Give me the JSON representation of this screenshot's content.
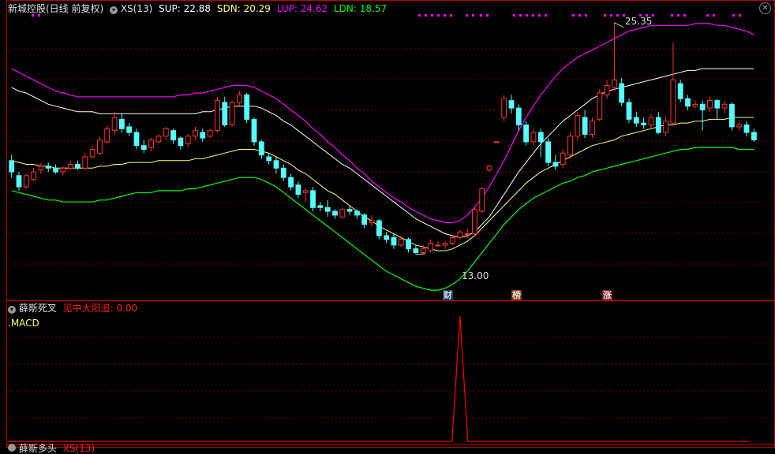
{
  "main_header": {
    "title": "新城控股(日线 前复权)",
    "indicator": "XS(13)",
    "sup_label": "SUP:",
    "sup": "22.88",
    "sdn_label": "SDN:",
    "sdn": "20.29",
    "lup_label": "LUP:",
    "lup": "24.62",
    "ldn_label": "LDN:",
    "ldn": "18.57"
  },
  "sub_header": {
    "name": "薛斯死叉",
    "signal_label": "见中大阳追:",
    "signal_value": "0.00",
    "macd_label": ".MACD"
  },
  "bottom_header": {
    "name": "薛斯多头",
    "text": "XS(13)"
  },
  "annotations": {
    "high": "25.35",
    "low": "13.00",
    "markers": [
      "财",
      "榜",
      "涨"
    ]
  },
  "colors": {
    "up": "#ff3232",
    "down": "#54ffff",
    "lup": "#ff00ff",
    "sup": "#ffffff",
    "sdn": "#ffff80",
    "ldn": "#00ff00",
    "frame": "#b40000",
    "grid": "#700000",
    "signal": "#ff0000"
  },
  "chart_data": {
    "type": "candlestick",
    "series": [
      {
        "name": "SUP"
      },
      {
        "name": "SDN"
      },
      {
        "name": "LUP"
      },
      {
        "name": "LDN"
      }
    ],
    "high": 25.35,
    "low": 13.0,
    "ohlc": [
      [
        18.0,
        17.4,
        18.3,
        17.1
      ],
      [
        17.2,
        16.6,
        17.4,
        16.4
      ],
      [
        16.6,
        17.2,
        17.3,
        16.5
      ],
      [
        17.0,
        17.4,
        17.6,
        16.9
      ],
      [
        17.5,
        17.7,
        17.9,
        17.3
      ],
      [
        17.7,
        17.6,
        17.9,
        17.4
      ],
      [
        17.6,
        17.4,
        17.8,
        17.3
      ],
      [
        17.4,
        17.6,
        17.7,
        17.2
      ],
      [
        17.6,
        17.8,
        18.0,
        17.5
      ],
      [
        17.8,
        17.6,
        18.0,
        17.5
      ],
      [
        17.6,
        18.2,
        18.4,
        17.5
      ],
      [
        18.2,
        18.6,
        18.8,
        18.1
      ],
      [
        18.4,
        19.1,
        19.3,
        18.3
      ],
      [
        19.0,
        19.7,
        19.9,
        18.9
      ],
      [
        19.6,
        20.3,
        20.6,
        19.4
      ],
      [
        20.2,
        19.7,
        20.5,
        19.5
      ],
      [
        19.8,
        19.5,
        20.0,
        19.3
      ],
      [
        19.5,
        18.8,
        19.7,
        18.6
      ],
      [
        18.8,
        18.6,
        19.1,
        18.4
      ],
      [
        18.7,
        19.1,
        19.2,
        18.5
      ],
      [
        19.0,
        19.3,
        19.4,
        18.9
      ],
      [
        19.3,
        19.7,
        19.8,
        19.1
      ],
      [
        19.6,
        19.1,
        19.7,
        18.9
      ],
      [
        19.2,
        18.8,
        19.3,
        18.6
      ],
      [
        18.9,
        19.3,
        19.4,
        18.7
      ],
      [
        19.3,
        19.6,
        19.8,
        19.1
      ],
      [
        19.5,
        19.2,
        19.7,
        19.0
      ],
      [
        19.3,
        19.6,
        19.7,
        19.2
      ],
      [
        19.6,
        21.2,
        21.4,
        19.5
      ],
      [
        21.1,
        19.9,
        21.4,
        19.8
      ],
      [
        19.9,
        21.1,
        21.2,
        19.8
      ],
      [
        21.1,
        21.5,
        21.7,
        20.9
      ],
      [
        21.5,
        20.2,
        21.6,
        20.0
      ],
      [
        20.2,
        19.0,
        20.3,
        18.8
      ],
      [
        19.0,
        18.3,
        19.1,
        18.1
      ],
      [
        18.2,
        18.0,
        18.4,
        17.8
      ],
      [
        18.0,
        17.6,
        18.2,
        17.3
      ],
      [
        17.6,
        17.1,
        17.8,
        16.9
      ],
      [
        17.1,
        16.6,
        17.3,
        16.4
      ],
      [
        16.7,
        16.2,
        16.9,
        16.0
      ],
      [
        16.3,
        16.4,
        16.5,
        15.8
      ],
      [
        16.4,
        15.5,
        16.6,
        15.3
      ],
      [
        15.6,
        15.5,
        15.8,
        15.3
      ],
      [
        15.5,
        15.3,
        15.9,
        15.0
      ],
      [
        15.3,
        15.1,
        15.4,
        14.9
      ],
      [
        15.0,
        15.4,
        15.5,
        14.9
      ],
      [
        15.4,
        15.3,
        15.6,
        15.1
      ],
      [
        15.3,
        15.1,
        15.4,
        14.9
      ],
      [
        15.1,
        14.6,
        15.2,
        14.4
      ],
      [
        14.7,
        14.8,
        15.1,
        14.5
      ],
      [
        14.8,
        14.0,
        14.9,
        13.8
      ],
      [
        14.0,
        13.8,
        14.2,
        13.6
      ],
      [
        13.9,
        13.5,
        14.1,
        13.3
      ],
      [
        13.5,
        13.8,
        13.9,
        13.4
      ],
      [
        13.8,
        13.3,
        13.9,
        13.1
      ],
      [
        13.3,
        13.1,
        13.5,
        13.0
      ],
      [
        13.1,
        13.3,
        13.5,
        13.0
      ],
      [
        13.2,
        13.6,
        13.8,
        13.1
      ],
      [
        13.5,
        13.5,
        13.7,
        13.4
      ],
      [
        13.5,
        13.6,
        13.7,
        13.3
      ],
      [
        13.6,
        13.9,
        14.0,
        13.5
      ],
      [
        13.9,
        14.2,
        14.3,
        13.8
      ],
      [
        14.1,
        14.1,
        14.4,
        13.9
      ],
      [
        14.1,
        15.4,
        15.5,
        14.0
      ],
      [
        15.3,
        16.5,
        16.6,
        15.2
      ],
      [
        17.5,
        17.7,
        17.8,
        17.4
      ],
      [
        19.0,
        19.0,
        19.0,
        19.0
      ],
      [
        20.3,
        21.3,
        21.5,
        20.1
      ],
      [
        21.2,
        20.8,
        21.5,
        20.5
      ],
      [
        20.8,
        19.9,
        21.0,
        19.6
      ],
      [
        19.9,
        19.0,
        20.1,
        18.8
      ],
      [
        19.0,
        19.5,
        19.7,
        18.8
      ],
      [
        19.5,
        19.0,
        19.7,
        18.2
      ],
      [
        19.0,
        17.9,
        19.2,
        17.7
      ],
      [
        17.9,
        17.7,
        18.3,
        17.5
      ],
      [
        17.8,
        18.4,
        18.6,
        17.6
      ],
      [
        18.3,
        19.3,
        19.5,
        18.1
      ],
      [
        19.3,
        20.4,
        20.6,
        19.1
      ],
      [
        20.3,
        19.4,
        20.7,
        19.2
      ],
      [
        19.4,
        20.1,
        20.3,
        19.2
      ],
      [
        20.2,
        21.6,
        21.8,
        20.1
      ],
      [
        21.5,
        22.0,
        22.3,
        21.3
      ],
      [
        21.9,
        22.3,
        25.35,
        21.7
      ],
      [
        22.1,
        21.1,
        22.4,
        20.9
      ],
      [
        21.1,
        20.2,
        21.3,
        20.0
      ],
      [
        20.3,
        20.0,
        20.6,
        19.8
      ],
      [
        20.0,
        19.9,
        20.3,
        19.7
      ],
      [
        19.9,
        20.3,
        20.5,
        19.7
      ],
      [
        20.3,
        19.5,
        20.6,
        19.4
      ],
      [
        19.5,
        20.1,
        20.3,
        19.3
      ],
      [
        20.0,
        22.3,
        24.3,
        19.9
      ],
      [
        22.1,
        21.3,
        22.3,
        21.1
      ],
      [
        21.3,
        20.9,
        21.5,
        20.7
      ],
      [
        20.9,
        21.0,
        21.2,
        20.8
      ],
      [
        21.0,
        20.7,
        21.2,
        19.6
      ],
      [
        20.8,
        21.2,
        21.4,
        20.6
      ],
      [
        21.2,
        20.8,
        21.3,
        20.2
      ],
      [
        20.8,
        21.0,
        21.2,
        20.5
      ],
      [
        21.0,
        19.8,
        21.1,
        19.6
      ],
      [
        19.8,
        19.9,
        20.1,
        19.6
      ],
      [
        19.9,
        19.5,
        20.1,
        19.3
      ],
      [
        19.5,
        19.1,
        19.7,
        19.0
      ]
    ],
    "sup": [
      21.9,
      21.7,
      21.6,
      21.4,
      21.2,
      21.0,
      20.9,
      20.8,
      20.7,
      20.6,
      20.6,
      20.6,
      20.5,
      20.5,
      20.5,
      20.5,
      20.5,
      20.5,
      20.5,
      20.5,
      20.5,
      20.5,
      20.5,
      20.5,
      20.5,
      20.5,
      20.6,
      20.6,
      20.7,
      20.8,
      20.9,
      20.9,
      20.9,
      20.9,
      20.8,
      20.6,
      20.4,
      20.1,
      19.9,
      19.6,
      19.3,
      19.0,
      18.7,
      18.4,
      18.1,
      17.8,
      17.6,
      17.3,
      17.0,
      16.7,
      16.4,
      16.1,
      15.8,
      15.5,
      15.2,
      14.9,
      14.7,
      14.5,
      14.3,
      14.1,
      14.0,
      13.9,
      14.0,
      14.2,
      14.6,
      15.0,
      15.6,
      16.2,
      16.8,
      17.4,
      17.9,
      18.4,
      18.9,
      19.3,
      19.7,
      20.1,
      20.4,
      20.7,
      21.0,
      21.3,
      21.5,
      21.7,
      21.8,
      21.9,
      22.0,
      22.1,
      22.2,
      22.3,
      22.4,
      22.5,
      22.6,
      22.7,
      22.8,
      22.8,
      22.9,
      22.9,
      22.9,
      22.9,
      22.9,
      22.9,
      22.9,
      22.9
    ],
    "sdn": [
      18.0,
      17.9,
      17.8,
      17.8,
      17.7,
      17.7,
      17.6,
      17.6,
      17.6,
      17.6,
      17.6,
      17.6,
      17.7,
      17.7,
      17.8,
      17.8,
      17.9,
      17.9,
      17.9,
      17.9,
      18.0,
      18.0,
      18.0,
      18.0,
      18.0,
      18.1,
      18.1,
      18.2,
      18.3,
      18.4,
      18.5,
      18.6,
      18.6,
      18.6,
      18.5,
      18.4,
      18.2,
      18.0,
      17.8,
      17.5,
      17.3,
      17.0,
      16.7,
      16.4,
      16.2,
      15.9,
      15.6,
      15.3,
      15.0,
      14.8,
      14.5,
      14.3,
      14.1,
      13.9,
      13.7,
      13.5,
      13.4,
      13.3,
      13.2,
      13.2,
      13.3,
      13.5,
      13.7,
      14.0,
      14.4,
      14.8,
      15.2,
      15.6,
      16.0,
      16.4,
      16.8,
      17.1,
      17.4,
      17.6,
      17.8,
      18.0,
      18.2,
      18.4,
      18.6,
      18.8,
      18.9,
      19.0,
      19.1,
      19.3,
      19.4,
      19.5,
      19.6,
      19.7,
      19.8,
      19.9,
      19.9,
      20.0,
      20.0,
      20.1,
      20.1,
      20.2,
      20.2,
      20.2,
      20.3,
      20.3,
      20.3,
      20.3
    ],
    "lup": [
      22.9,
      22.7,
      22.5,
      22.3,
      22.1,
      21.9,
      21.7,
      21.6,
      21.5,
      21.4,
      21.4,
      21.4,
      21.4,
      21.4,
      21.4,
      21.4,
      21.4,
      21.4,
      21.4,
      21.4,
      21.4,
      21.4,
      21.4,
      21.5,
      21.5,
      21.6,
      21.6,
      21.7,
      21.8,
      21.9,
      22.0,
      22.0,
      22.0,
      21.9,
      21.7,
      21.5,
      21.3,
      21.0,
      20.7,
      20.4,
      20.1,
      19.7,
      19.4,
      19.0,
      18.7,
      18.3,
      18.0,
      17.6,
      17.3,
      16.9,
      16.6,
      16.3,
      16.0,
      15.8,
      15.5,
      15.3,
      15.1,
      14.9,
      14.8,
      14.7,
      14.7,
      14.8,
      15.1,
      15.5,
      16.0,
      16.6,
      17.3,
      18.0,
      18.8,
      19.6,
      20.3,
      20.9,
      21.5,
      22.0,
      22.5,
      22.9,
      23.2,
      23.5,
      23.7,
      23.9,
      24.1,
      24.3,
      24.5,
      24.7,
      24.9,
      25.0,
      25.1,
      25.2,
      25.2,
      25.2,
      25.2,
      25.2,
      25.2,
      25.3,
      25.3,
      25.3,
      25.2,
      25.2,
      25.1,
      25.0,
      24.9,
      24.7
    ],
    "ldn": [
      16.4,
      16.3,
      16.2,
      16.1,
      16.0,
      15.9,
      15.9,
      15.8,
      15.8,
      15.8,
      15.8,
      15.8,
      15.9,
      15.9,
      16.0,
      16.1,
      16.2,
      16.3,
      16.3,
      16.3,
      16.4,
      16.4,
      16.4,
      16.4,
      16.5,
      16.5,
      16.6,
      16.7,
      16.8,
      16.9,
      17.0,
      17.1,
      17.1,
      17.1,
      17.0,
      16.8,
      16.6,
      16.3,
      16.0,
      15.7,
      15.4,
      15.1,
      14.8,
      14.5,
      14.2,
      13.9,
      13.6,
      13.3,
      13.0,
      12.7,
      12.4,
      12.1,
      11.9,
      11.7,
      11.5,
      11.3,
      11.2,
      11.1,
      11.1,
      11.2,
      11.4,
      11.7,
      12.1,
      12.6,
      13.1,
      13.6,
      14.1,
      14.6,
      15.0,
      15.4,
      15.7,
      16.0,
      16.2,
      16.4,
      16.6,
      16.8,
      16.9,
      17.1,
      17.2,
      17.4,
      17.5,
      17.6,
      17.7,
      17.8,
      17.9,
      18.0,
      18.1,
      18.2,
      18.3,
      18.4,
      18.5,
      18.6,
      18.6,
      18.7,
      18.7,
      18.7,
      18.7,
      18.7,
      18.7,
      18.6,
      18.6,
      18.6
    ],
    "sub_signal": {
      "name": "见中大阳追",
      "peak_index": 63
    }
  }
}
